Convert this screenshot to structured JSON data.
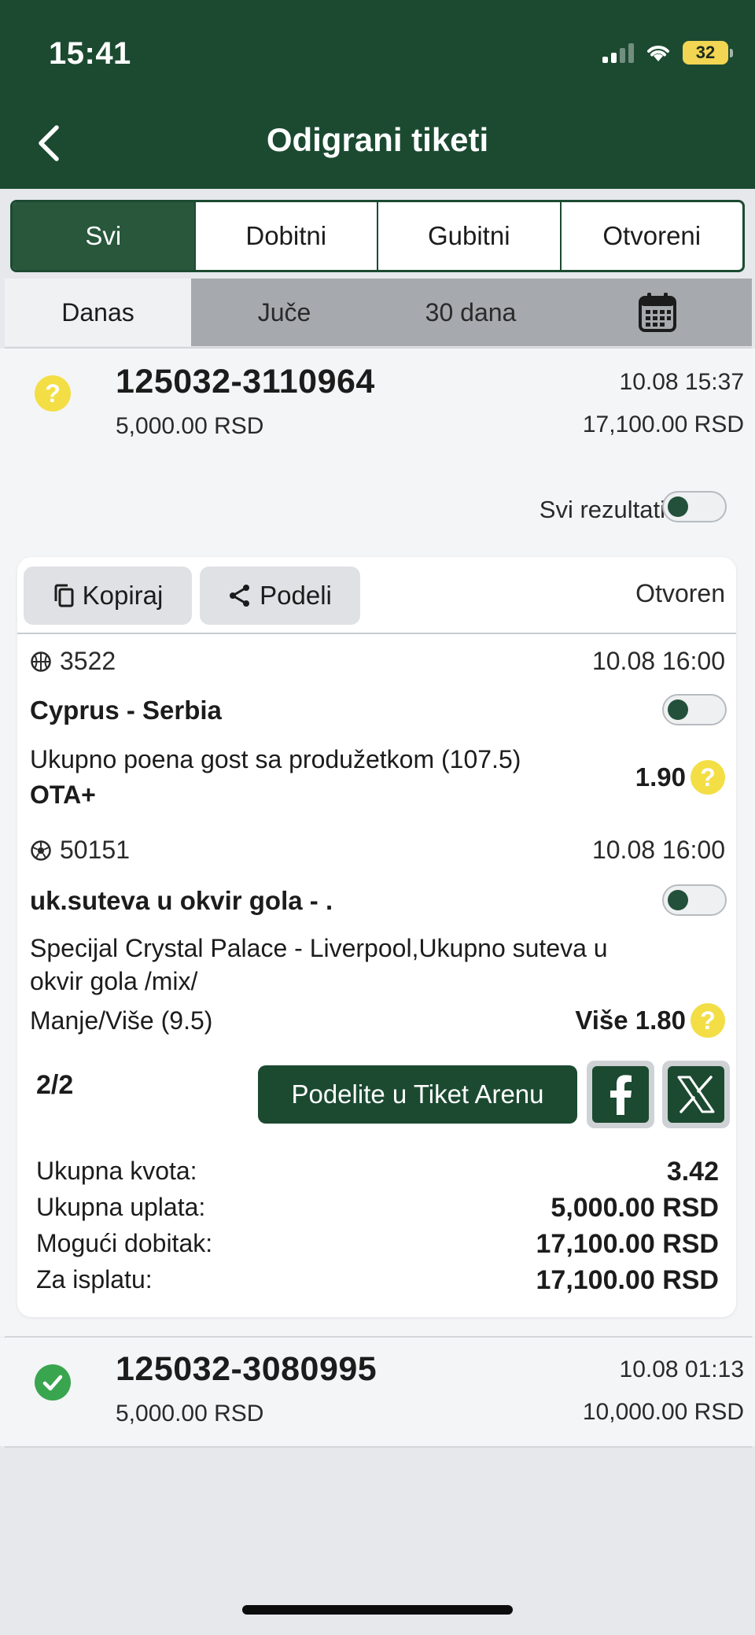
{
  "status_bar": {
    "time": "15:41",
    "battery": "32"
  },
  "header": {
    "title": "Odigrani tiketi"
  },
  "tabs": [
    "Svi",
    "Dobitni",
    "Gubitni",
    "Otvoreni"
  ],
  "filters": {
    "today": "Danas",
    "yesterday": "Juče",
    "thirty_days": "30 dana"
  },
  "ticket1": {
    "id": "125032-3110964",
    "date": "10.08 15:37",
    "stake": "5,000.00 RSD",
    "win": "17,100.00 RSD",
    "status_icon": "question-icon",
    "status_mark": "?"
  },
  "all_results": {
    "label": "Svi rezultati"
  },
  "card": {
    "copy_label": "Kopiraj",
    "share_label": "Podeli",
    "state": "Otvoren",
    "events": [
      {
        "sport_icon": "basketball-icon",
        "code": "3522",
        "time": "10.08 16:00",
        "match": "Cyprus - Serbia",
        "market": "Ukupno poena gost sa produžetkom (107.5)",
        "pick": "OTA+",
        "odd": "1.90"
      },
      {
        "sport_icon": "soccer-ball-icon",
        "code": "50151",
        "time": "10.08 16:00",
        "match": "uk.suteva u okvir gola - .",
        "market_line1": "Specijal Crystal Palace - Liverpool,Ukupno suteva u",
        "market_line2": "okvir gola /mix/",
        "market_line3": "Manje/Više (9.5)",
        "odd": "Više 1.80"
      }
    ],
    "count": "2/2",
    "arena_label": "Podelite u Tiket Arenu",
    "summary": {
      "odds_label": "Ukupna kvota:",
      "odds_value": "3.42",
      "stake_label": "Ukupna uplata:",
      "stake_value": "5,000.00 RSD",
      "possible_label": "Mogući dobitak:",
      "possible_value": "17,100.00 RSD",
      "payout_label": "Za isplatu:",
      "payout_value": "17,100.00 RSD"
    }
  },
  "ticket2": {
    "id": "125032-3080995",
    "date": "10.08 01:13",
    "stake": "5,000.00 RSD",
    "win": "10,000.00 RSD",
    "status_icon": "check-icon"
  },
  "colors": {
    "primary": "#1b4a31",
    "accent_yellow": "#f3de45",
    "success": "#3aa54f"
  }
}
